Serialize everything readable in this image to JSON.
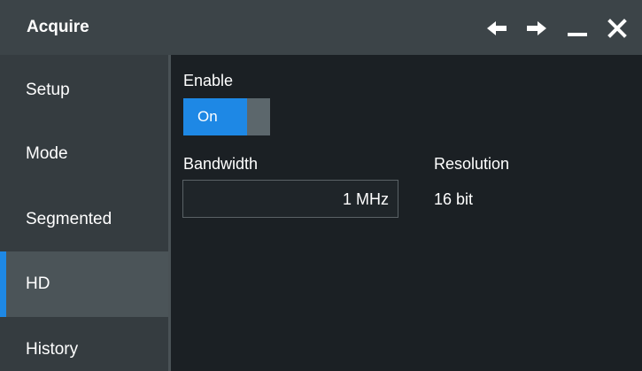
{
  "window": {
    "title": "Acquire",
    "icons": [
      "arrow-left-icon",
      "arrow-right-icon",
      "minimize-icon",
      "close-icon"
    ]
  },
  "sidebar": {
    "items": [
      {
        "label": "Setup",
        "active": false
      },
      {
        "label": "Mode",
        "active": false
      },
      {
        "label": "Segmented",
        "active": false
      },
      {
        "label": "HD",
        "active": true
      },
      {
        "label": "History",
        "active": false
      }
    ]
  },
  "main": {
    "enable": {
      "label": "Enable",
      "state": "On"
    },
    "bandwidth": {
      "label": "Bandwidth",
      "value": "1 MHz"
    },
    "resolution": {
      "label": "Resolution",
      "value": "16 bit"
    }
  },
  "colors": {
    "accent": "#1e88e5",
    "titlebar": "#3c4448",
    "sidebar": "#353c40",
    "active_item": "#4b5458",
    "background": "#1b2024"
  }
}
